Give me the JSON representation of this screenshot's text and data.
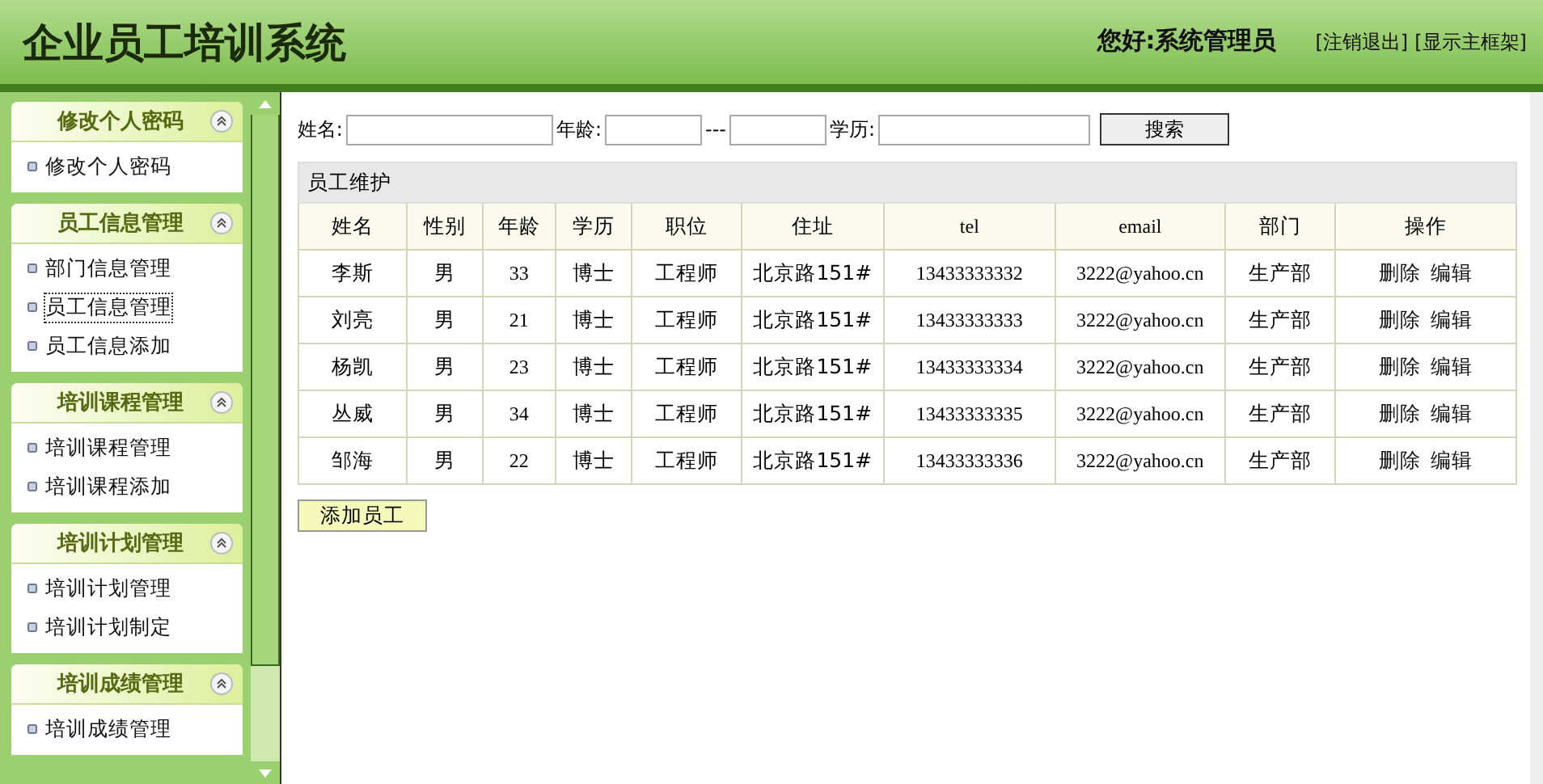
{
  "header": {
    "title": "企业员工培训系统",
    "greeting": "您好:系统管理员",
    "links": [
      "[注销退出]",
      "[显示主框架]"
    ]
  },
  "sidebar": {
    "groups": [
      {
        "title": "修改个人密码",
        "expanded": true,
        "items": [
          {
            "label": "修改个人密码",
            "selected": false
          }
        ]
      },
      {
        "title": "员工信息管理",
        "expanded": true,
        "items": [
          {
            "label": "部门信息管理",
            "selected": false
          },
          {
            "label": "员工信息管理",
            "selected": true
          },
          {
            "label": "员工信息添加",
            "selected": false
          }
        ]
      },
      {
        "title": "培训课程管理",
        "expanded": true,
        "items": [
          {
            "label": "培训课程管理",
            "selected": false
          },
          {
            "label": "培训课程添加",
            "selected": false
          }
        ]
      },
      {
        "title": "培训计划管理",
        "expanded": true,
        "items": [
          {
            "label": "培训计划管理",
            "selected": false
          },
          {
            "label": "培训计划制定",
            "selected": false
          }
        ]
      },
      {
        "title": "培训成绩管理",
        "expanded": true,
        "items": [
          {
            "label": "培训成绩管理",
            "selected": false
          }
        ]
      }
    ]
  },
  "search": {
    "name_label": "姓名:",
    "age_label": "年龄:",
    "age_separator": "---",
    "education_label": "学历:",
    "button": "搜索"
  },
  "table": {
    "caption": "员工维护",
    "columns": [
      "姓名",
      "性别",
      "年龄",
      "学历",
      "职位",
      "住址",
      "tel",
      "email",
      "部门",
      "操作"
    ],
    "rows": [
      {
        "cells": [
          "李斯",
          "男",
          "33",
          "博士",
          "工程师",
          "北京路151#",
          "13433333332",
          "3222@yahoo.cn",
          "生产部"
        ],
        "actions": [
          "删除",
          "编辑"
        ]
      },
      {
        "cells": [
          "刘亮",
          "男",
          "21",
          "博士",
          "工程师",
          "北京路151#",
          "13433333333",
          "3222@yahoo.cn",
          "生产部"
        ],
        "actions": [
          "删除",
          "编辑"
        ]
      },
      {
        "cells": [
          "杨凯",
          "男",
          "23",
          "博士",
          "工程师",
          "北京路151#",
          "13433333334",
          "3222@yahoo.cn",
          "生产部"
        ],
        "actions": [
          "删除",
          "编辑"
        ]
      },
      {
        "cells": [
          "丛威",
          "男",
          "34",
          "博士",
          "工程师",
          "北京路151#",
          "13433333335",
          "3222@yahoo.cn",
          "生产部"
        ],
        "actions": [
          "删除",
          "编辑"
        ]
      },
      {
        "cells": [
          "邹海",
          "男",
          "22",
          "博士",
          "工程师",
          "北京路151#",
          "13433333336",
          "3222@yahoo.cn",
          "生产部"
        ],
        "actions": [
          "删除",
          "编辑"
        ]
      }
    ]
  },
  "add_button": "添加员工"
}
